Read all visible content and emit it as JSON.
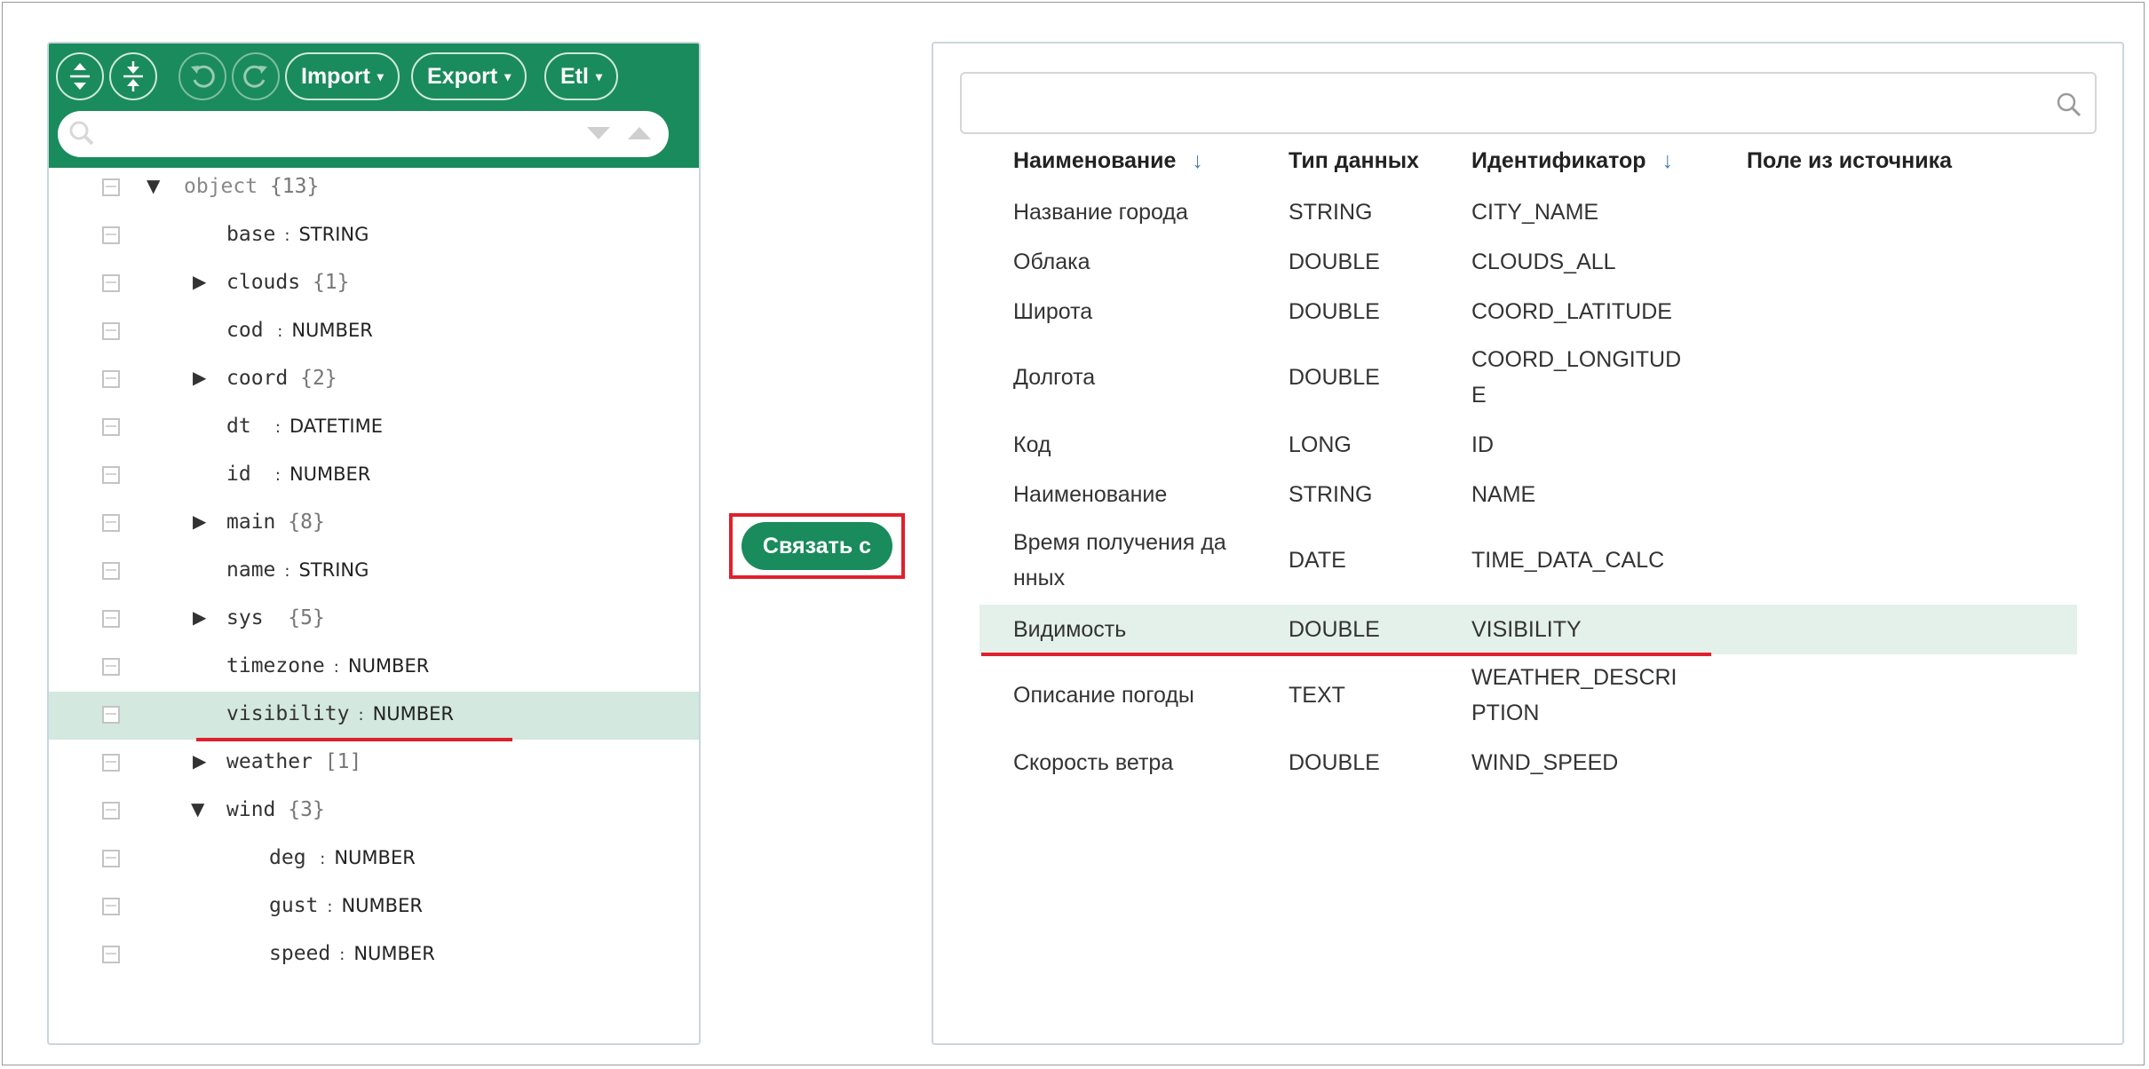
{
  "toolbar": {
    "import_label": "Import",
    "export_label": "Export",
    "etl_label": "Etl"
  },
  "tree": {
    "root_name": "object",
    "root_count": "{13}",
    "nodes": [
      {
        "name": "base",
        "type": "STRING",
        "count": ""
      },
      {
        "name": "clouds",
        "type": "",
        "count": "{1}"
      },
      {
        "name": "cod",
        "type": "NUMBER",
        "count": ""
      },
      {
        "name": "coord",
        "type": "",
        "count": "{2}"
      },
      {
        "name": "dt",
        "type": "DATETIME",
        "count": ""
      },
      {
        "name": "id",
        "type": "NUMBER",
        "count": ""
      },
      {
        "name": "main",
        "type": "",
        "count": "{8}"
      },
      {
        "name": "name",
        "type": "STRING",
        "count": ""
      },
      {
        "name": "sys",
        "type": "",
        "count": "{5}"
      },
      {
        "name": "timezone",
        "type": "NUMBER",
        "count": ""
      },
      {
        "name": "visibility",
        "type": "NUMBER",
        "count": ""
      },
      {
        "name": "weather",
        "type": "",
        "count": "[1]"
      },
      {
        "name": "wind",
        "type": "",
        "count": "{3}"
      },
      {
        "name": "deg",
        "type": "NUMBER",
        "count": ""
      },
      {
        "name": "gust",
        "type": "NUMBER",
        "count": ""
      },
      {
        "name": "speed",
        "type": "NUMBER",
        "count": ""
      }
    ]
  },
  "link_button_label": "Связать с",
  "table": {
    "headers": {
      "name": "Наименование",
      "type": "Тип данных",
      "id": "Идентификатор",
      "source": "Поле из источника"
    },
    "rows": [
      {
        "name": "Название города",
        "type": "STRING",
        "id": "CITY_NAME",
        "source": ""
      },
      {
        "name": "Облака",
        "type": "DOUBLE",
        "id": "CLOUDS_ALL",
        "source": ""
      },
      {
        "name": "Широта",
        "type": "DOUBLE",
        "id": "COORD_LATITUDE",
        "source": ""
      },
      {
        "name": "Долгота",
        "type": "DOUBLE",
        "id": "COORD_LONGITUDE",
        "source": ""
      },
      {
        "name": "Код",
        "type": "LONG",
        "id": "ID",
        "source": ""
      },
      {
        "name": "Наименование",
        "type": "STRING",
        "id": "NAME",
        "source": ""
      },
      {
        "name": "Время получения данных",
        "type": "DATE",
        "id": "TIME_DATA_CALC",
        "source": ""
      },
      {
        "name": "Видимость",
        "type": "DOUBLE",
        "id": "VISIBILITY",
        "source": ""
      },
      {
        "name": "Описание погоды",
        "type": "TEXT",
        "id": "WEATHER_DESCRIPTION",
        "source": ""
      },
      {
        "name": "Скорость ветра",
        "type": "DOUBLE",
        "id": "WIND_SPEED",
        "source": ""
      }
    ]
  },
  "colors": {
    "accent_green": "#1a8b5c",
    "selection_left": "#d3e8df",
    "selection_right": "#e4f0ea",
    "highlight_red": "#e0202c"
  }
}
